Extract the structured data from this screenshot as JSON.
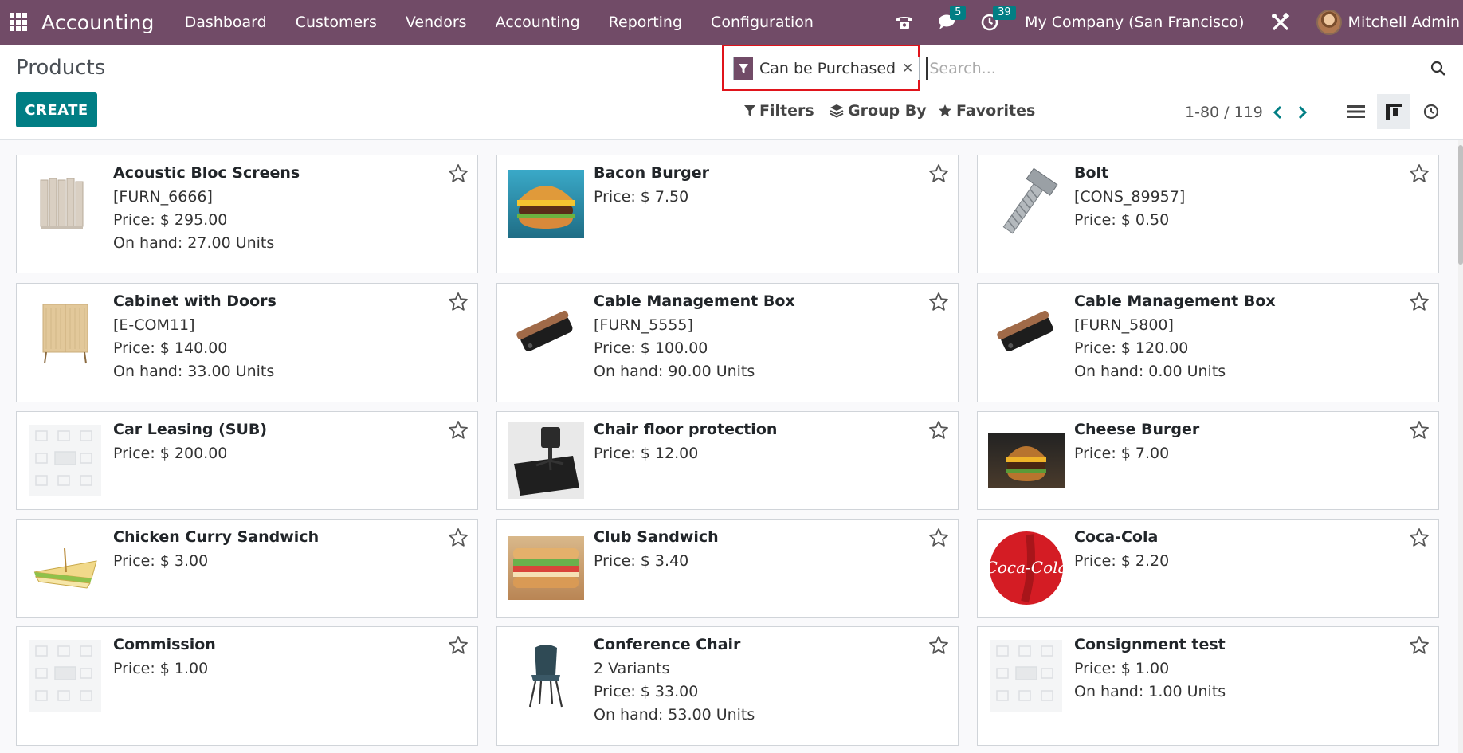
{
  "navbar": {
    "app_name": "Accounting",
    "menu": [
      "Dashboard",
      "Customers",
      "Vendors",
      "Accounting",
      "Reporting",
      "Configuration"
    ],
    "messages_count": "5",
    "activities_count": "39",
    "company": "My Company (San Francisco)",
    "user": "Mitchell Admin"
  },
  "control": {
    "title": "Products",
    "create_label": "CREATE",
    "facet_label": "Can be Purchased",
    "search_placeholder": "Search...",
    "filters_label": "Filters",
    "groupby_label": "Group By",
    "favorites_label": "Favorites",
    "pager": "1-80 / 119"
  },
  "products": [
    {
      "name": "Acoustic Bloc Screens",
      "lines": [
        "[FURN_6666]",
        "Price: $ 295.00",
        "On hand: 27.00 Units"
      ],
      "image": "screens"
    },
    {
      "name": "Bacon Burger",
      "lines": [
        "Price: $ 7.50"
      ],
      "image": "burger"
    },
    {
      "name": "Bolt",
      "lines": [
        "[CONS_89957]",
        "Price: $ 0.50"
      ],
      "image": "bolt"
    },
    {
      "name": "Cabinet with Doors",
      "lines": [
        "[E-COM11]",
        "Price: $ 140.00",
        "On hand: 33.00 Units"
      ],
      "image": "cabinet"
    },
    {
      "name": "Cable Management Box",
      "lines": [
        "[FURN_5555]",
        "Price: $ 100.00",
        "On hand: 90.00 Units"
      ],
      "image": "cablebox"
    },
    {
      "name": "Cable Management Box",
      "lines": [
        "[FURN_5800]",
        "Price: $ 120.00",
        "On hand: 0.00 Units"
      ],
      "image": "cablebox"
    },
    {
      "name": "Car Leasing (SUB)",
      "lines": [
        "Price: $ 200.00"
      ],
      "image": "placeholder"
    },
    {
      "name": "Chair floor protection",
      "lines": [
        "Price: $ 12.00"
      ],
      "image": "floormat"
    },
    {
      "name": "Cheese Burger",
      "lines": [
        "Price: $ 7.00"
      ],
      "image": "burger-dark"
    },
    {
      "name": "Chicken Curry Sandwich",
      "lines": [
        "Price: $ 3.00"
      ],
      "image": "sandwich"
    },
    {
      "name": "Club Sandwich",
      "lines": [
        "Price: $ 3.40"
      ],
      "image": "club"
    },
    {
      "name": "Coca-Cola",
      "lines": [
        "Price: $ 2.20"
      ],
      "image": "cocacola"
    },
    {
      "name": "Commission",
      "lines": [
        "Price: $ 1.00"
      ],
      "image": "placeholder"
    },
    {
      "name": "Conference Chair",
      "lines": [
        "2 Variants",
        "Price: $ 33.00",
        "On hand: 53.00 Units"
      ],
      "image": "chair"
    },
    {
      "name": "Consignment test",
      "lines": [
        "Price: $ 1.00",
        "On hand: 1.00 Units"
      ],
      "image": "placeholder"
    }
  ]
}
